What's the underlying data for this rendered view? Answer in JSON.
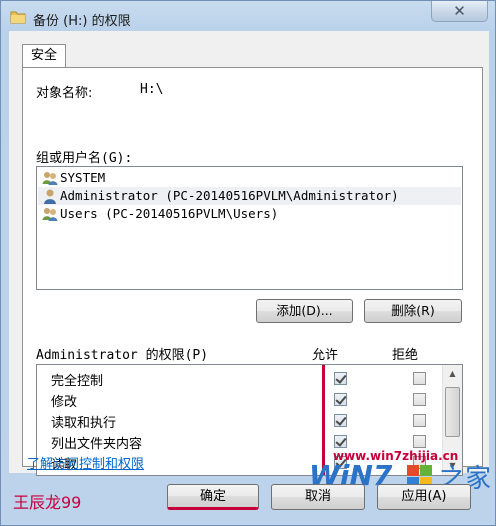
{
  "window": {
    "title": "备份 (H:) 的权限",
    "close_glyph": "✕"
  },
  "tabs": [
    {
      "label": "安全"
    }
  ],
  "object": {
    "label": "对象名称:",
    "value": "H:\\"
  },
  "groups": {
    "label": "组或用户名(G):",
    "items": [
      {
        "name": "SYSTEM",
        "icon": "users-group-icon"
      },
      {
        "name": "Administrator (PC-20140516PVLM\\Administrator)",
        "icon": "user-icon"
      },
      {
        "name": "Users (PC-20140516PVLM\\Users)",
        "icon": "users-group-icon"
      }
    ],
    "selected_index": 1
  },
  "buttons": {
    "add": "添加(D)...",
    "remove": "删除(R)"
  },
  "permissions": {
    "label": "Administrator 的权限(P)",
    "allow_header": "允许",
    "deny_header": "拒绝",
    "rows": [
      {
        "name": "完全控制",
        "allow": true,
        "deny": false
      },
      {
        "name": "修改",
        "allow": true,
        "deny": false
      },
      {
        "name": "读取和执行",
        "allow": true,
        "deny": false
      },
      {
        "name": "列出文件夹内容",
        "allow": true,
        "deny": false
      },
      {
        "name": "读取",
        "allow": true,
        "deny": false
      }
    ]
  },
  "help_link": "了解访问控制和权限",
  "footer": {
    "ok": "确定",
    "cancel": "取消",
    "apply": "应用(A)"
  },
  "overlay": {
    "author": "王辰龙99",
    "site_url": "www.win7zhijia.cn",
    "logo_text": "WiN7",
    "logo_suffix": "之家"
  },
  "colors": {
    "accent_red": "#c8003a",
    "link_blue": "#0066cc",
    "titlebar": "#b9d1ea"
  }
}
